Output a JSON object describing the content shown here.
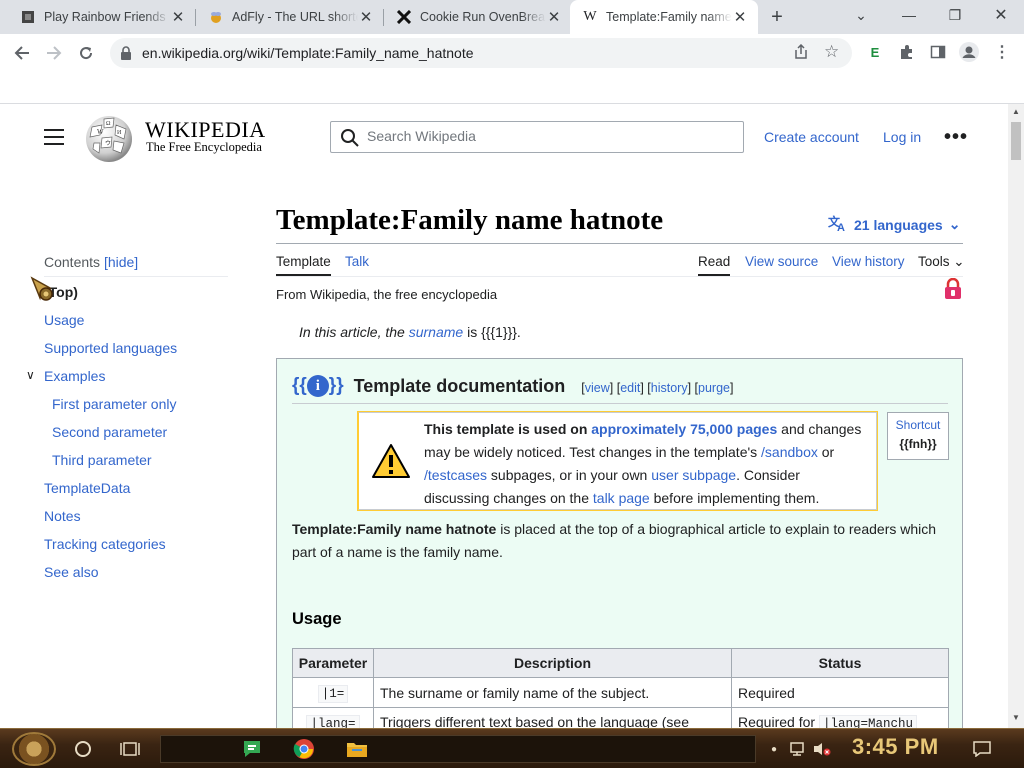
{
  "browser": {
    "tabs": [
      {
        "title": "Play Rainbow Friends",
        "active": false
      },
      {
        "title": "AdFly - The URL shortener",
        "active": false
      },
      {
        "title": "Cookie Run OvenBreak",
        "active": false
      },
      {
        "title": "Template:Family name hatnote",
        "active": true
      }
    ],
    "url": "en.wikipedia.org/wiki/Template:Family_name_hatnote",
    "extension_label": "E"
  },
  "wiki": {
    "wordmark": "WIKIPEDIA",
    "tagline": "The Free Encyclopedia",
    "search_placeholder": "Search Wikipedia",
    "create_account": "Create account",
    "log_in": "Log in"
  },
  "toc": {
    "title": "Contents",
    "hide": "[hide]",
    "items": [
      {
        "label": "(Top)"
      },
      {
        "label": "Usage"
      },
      {
        "label": "Supported languages"
      },
      {
        "label": "Examples"
      },
      {
        "label": "First parameter only"
      },
      {
        "label": "Second parameter"
      },
      {
        "label": "Third parameter"
      },
      {
        "label": "TemplateData"
      },
      {
        "label": "Notes"
      },
      {
        "label": "Tracking categories"
      },
      {
        "label": "See also"
      }
    ]
  },
  "article": {
    "title": "Template:Family name hatnote",
    "languages": "21 languages",
    "tab_template": "Template",
    "tab_talk": "Talk",
    "tab_read": "Read",
    "tab_view_source": "View source",
    "tab_view_history": "View history",
    "tab_tools": "Tools",
    "from": "From Wikipedia, the free encyclopedia",
    "hatnote_pre": "In this article, the ",
    "hatnote_link": "surname",
    "hatnote_post": " is {{{1}}}."
  },
  "doc": {
    "braces_open": "{{",
    "braces_close": "}}",
    "info_icon": "i",
    "title": "Template documentation",
    "links": {
      "view": "view",
      "edit": "edit",
      "history": "history",
      "purge": "purge"
    },
    "notice": {
      "bold": "This template is used on ",
      "pages_link": "approximately 75,000 pages",
      "t1": " and changes may be widely noticed. Test changes in the template's ",
      "sandbox": "/sandbox",
      "t2": " or ",
      "testcases": "/testcases",
      "t3": " subpages, or in your own ",
      "userpage": "user subpage",
      "t4": ". Consider discussing changes on the ",
      "talk": "talk page",
      "t5": " before implementing them."
    },
    "shortcut_title": "Shortcut",
    "shortcut_value": "{{fnh}}",
    "desc_bold": "Template:Family name hatnote",
    "desc_rest": " is placed at the top of a biographical article to explain to readers which part of a name is the family name.",
    "usage_heading": "Usage",
    "table": {
      "headers": [
        "Parameter",
        "Description",
        "Status"
      ],
      "rows": [
        {
          "param": "|1=",
          "desc": "The surname or family name of the subject.",
          "status": "Required"
        },
        {
          "param": "|lang=",
          "desc": "Triggers different text based on the language (see",
          "status_pre": "Required for ",
          "status_code": "|lang=Manchu"
        }
      ]
    }
  },
  "taskbar": {
    "clock": "3:45 PM"
  }
}
